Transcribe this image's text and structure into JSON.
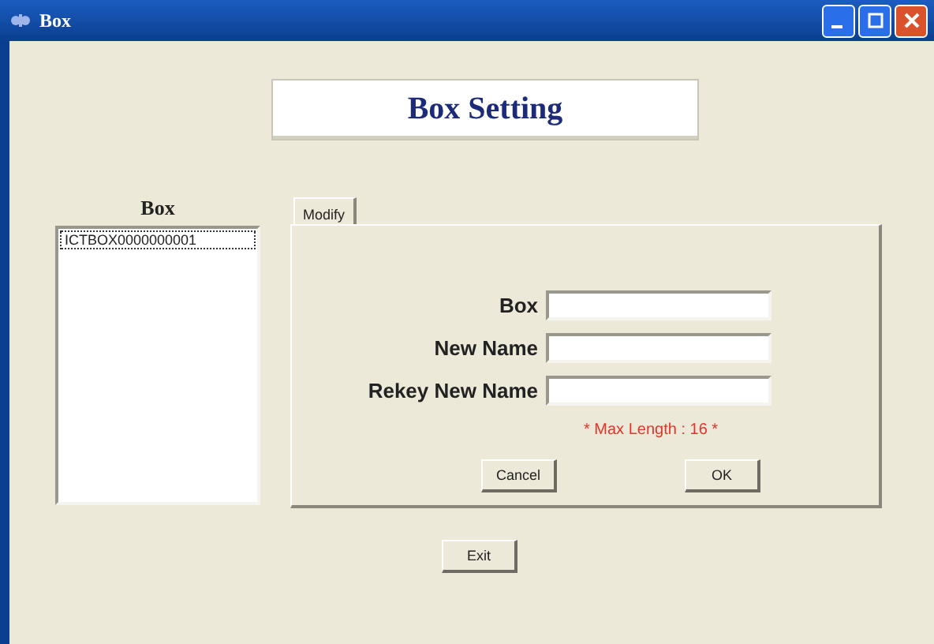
{
  "window": {
    "title": "Box"
  },
  "header": {
    "title": "Box Setting"
  },
  "box_list": {
    "label": "Box",
    "items": [
      {
        "text": "ICTBOX0000000001",
        "selected": true
      }
    ]
  },
  "tabs": [
    {
      "label": "Modify",
      "selected": true
    }
  ],
  "form": {
    "fields": [
      {
        "label": "Box"
      },
      {
        "label": "New Name"
      },
      {
        "label": "Rekey New Name"
      }
    ],
    "note": "* Max Length : 16 *",
    "buttons": [
      "Cancel",
      "OK"
    ]
  },
  "exit_button": "Exit"
}
